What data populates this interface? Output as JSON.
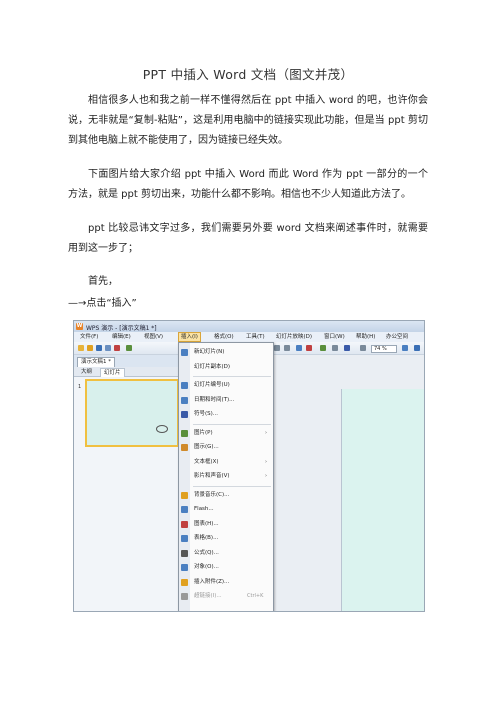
{
  "doc": {
    "title": "PPT 中插入 Word 文档（图文并茂）",
    "p1": "相信很多人也和我之前一样不懂得然后在 ppt 中插入 word 的吧，也许你会说，无非就是“复制-粘贴”，这是利用电脑中的链接实现此功能，但是当 ppt 剪切到其他电脑上就不能使用了，因为链接已经失效。",
    "p2": "下面图片给大家介绍 ppt 中插入 Word 而此 Word 作为 ppt 一部分的一个方法，就是 ppt 剪切出来，功能什么都不影响。相信也不少人知道此方法了。",
    "p3": "ppt 比较忌讳文字过多，我们需要另外要 word 文档来阐述事件时，就需要用到这一步了；",
    "p4": "首先，",
    "p5": "—→点击“插入”"
  },
  "shot": {
    "window_title": "WPS 演示 - [演示文稿1 *]",
    "menus": [
      "文件(F)",
      "编辑(E)",
      "视图(V)",
      "插入(I)",
      "格式(O)",
      "工具(T)",
      "幻灯片放映(D)",
      "窗口(W)",
      "帮助(H)",
      "办公空间"
    ],
    "zoom": "74 %",
    "doc_tab": "演示文稿1 *",
    "pane_tabs": [
      "大纲",
      "幻灯片"
    ],
    "slide_number": "1",
    "insert_menu": [
      {
        "label": "新幻灯片(N)",
        "icon_color": "#4a7fc1",
        "arrow": "",
        "shortcut": ""
      },
      {
        "label": "幻灯片副本(D)",
        "icon_color": "",
        "arrow": "",
        "shortcut": ""
      },
      {
        "label": "幻灯片编号(U)",
        "icon_color": "#4a7fc1",
        "arrow": "",
        "shortcut": ""
      },
      {
        "label": "日期和时间(T)...",
        "icon_color": "#4a7fc1",
        "arrow": "",
        "shortcut": ""
      },
      {
        "label": "符号(S)...",
        "icon_color": "#3a5aa8",
        "arrow": "",
        "shortcut": ""
      },
      {
        "label": "图片(P)",
        "icon_color": "#5a8f3c",
        "arrow": "›",
        "shortcut": ""
      },
      {
        "label": "图示(G)...",
        "icon_color": "#d08a2a",
        "arrow": "",
        "shortcut": ""
      },
      {
        "label": "文本框(X)",
        "icon_color": "",
        "arrow": "›",
        "shortcut": ""
      },
      {
        "label": "影片和声音(V)",
        "icon_color": "",
        "arrow": "›",
        "shortcut": ""
      },
      {
        "label": "背景音乐(C)...",
        "icon_color": "#e0a020",
        "arrow": "",
        "shortcut": ""
      },
      {
        "label": "Flash...",
        "icon_color": "#4a7fc1",
        "arrow": "",
        "shortcut": ""
      },
      {
        "label": "图表(H)...",
        "icon_color": "#c04040",
        "arrow": "",
        "shortcut": ""
      },
      {
        "label": "表格(B)...",
        "icon_color": "#4a7fc1",
        "arrow": "",
        "shortcut": ""
      },
      {
        "label": "公式(Q)...",
        "icon_color": "#555555",
        "arrow": "",
        "shortcut": ""
      },
      {
        "label": "对象(O)...",
        "icon_color": "#4a7fc1",
        "arrow": "",
        "shortcut": ""
      },
      {
        "label": "插入附件(Z)...",
        "icon_color": "#e0a020",
        "arrow": "",
        "shortcut": ""
      },
      {
        "label": "超链接(I)...",
        "icon_color": "#999999",
        "arrow": "",
        "shortcut": "Ctrl+K"
      }
    ]
  }
}
